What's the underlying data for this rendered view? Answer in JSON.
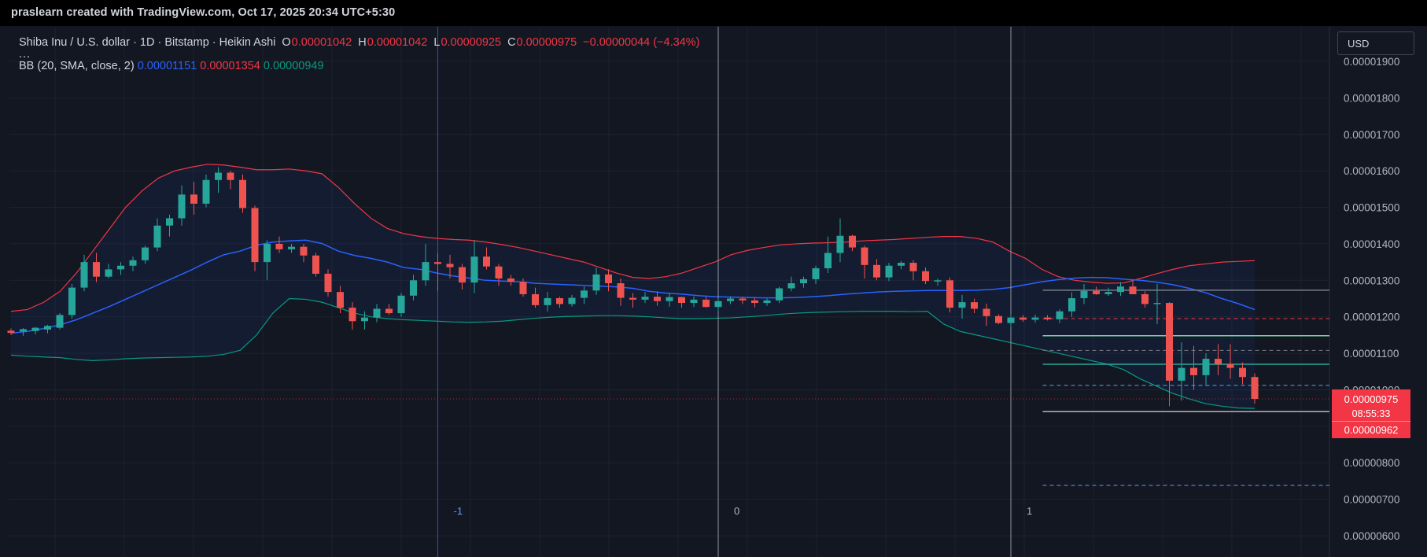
{
  "header": {
    "credit": "praslearn created with TradingView.com, Oct 17, 2025 20:34 UTC+5:30"
  },
  "legend": {
    "symbol": "Shiba Inu / U.S. dollar · 1D · Bitstamp · Heikin Ashi",
    "open_label": "O",
    "open": "0.00001042",
    "high_label": "H",
    "high": "0.00001042",
    "low_label": "L",
    "low": "0.00000925",
    "close_label": "C",
    "close": "0.00000975",
    "change": "−0.00000044 (−4.34%)",
    "more": "...",
    "bb_label": "BB (20, SMA, close, 2)",
    "bb_basis": "0.00001151",
    "bb_upper": "0.00001354",
    "bb_lower": "0.00000949"
  },
  "currency_button": "USD",
  "price_box": {
    "last": "0.00000975",
    "timer": "08:55:33",
    "low": "0.00000962"
  },
  "colors": {
    "up": "#089981",
    "down": "#f23645",
    "up_candle": "#26a69a",
    "down_candle": "#ef5350",
    "basis": "#2962ff",
    "upper": "#f23645",
    "lower": "#089981",
    "fill": "#2962ff",
    "orange": "#ff9800",
    "background": "#131722",
    "grid": "#1e222d",
    "text": "#b2b5be"
  },
  "chart_data": {
    "type": "candlestick",
    "style": "heikin-ashi",
    "title": "Shiba Inu / U.S. dollar · 1D · Bitstamp · Heikin Ashi",
    "yaxis": {
      "ticks": [
        "0.00001900",
        "0.00001800",
        "0.00001700",
        "0.00001600",
        "0.00001500",
        "0.00001400",
        "0.00001300",
        "0.00001200",
        "0.00001100",
        "0.00001000",
        "0.00000900",
        "0.00000800",
        "0.00000700",
        "0.00000600"
      ],
      "tick_values": [
        1900,
        1800,
        1700,
        1600,
        1500,
        1400,
        1300,
        1200,
        1100,
        1000,
        900,
        800,
        700,
        600
      ],
      "units": "1e-8 USD",
      "range": [
        580,
        1930
      ]
    },
    "x_markers": [
      {
        "label": "-1",
        "index": 35
      },
      {
        "label": "0",
        "index": 58
      },
      {
        "label": "1",
        "index": 82
      }
    ],
    "candles_ohlc": [
      [
        1162,
        1168,
        1150,
        1156
      ],
      [
        1160,
        1169,
        1148,
        1166
      ],
      [
        1161,
        1172,
        1152,
        1170
      ],
      [
        1165,
        1178,
        1155,
        1175
      ],
      [
        1170,
        1210,
        1165,
        1205
      ],
      [
        1205,
        1290,
        1195,
        1280
      ],
      [
        1280,
        1370,
        1270,
        1350
      ],
      [
        1350,
        1375,
        1295,
        1310
      ],
      [
        1310,
        1345,
        1305,
        1330
      ],
      [
        1330,
        1350,
        1315,
        1340
      ],
      [
        1340,
        1365,
        1325,
        1355
      ],
      [
        1355,
        1395,
        1345,
        1390
      ],
      [
        1390,
        1470,
        1380,
        1450
      ],
      [
        1450,
        1480,
        1420,
        1470
      ],
      [
        1470,
        1560,
        1450,
        1535
      ],
      [
        1535,
        1570,
        1480,
        1510
      ],
      [
        1510,
        1590,
        1500,
        1575
      ],
      [
        1575,
        1610,
        1540,
        1595
      ],
      [
        1595,
        1600,
        1550,
        1575
      ],
      [
        1575,
        1590,
        1485,
        1498
      ],
      [
        1498,
        1505,
        1325,
        1350
      ],
      [
        1350,
        1410,
        1300,
        1400
      ],
      [
        1400,
        1420,
        1375,
        1385
      ],
      [
        1385,
        1400,
        1375,
        1392
      ],
      [
        1392,
        1400,
        1350,
        1368
      ],
      [
        1368,
        1375,
        1310,
        1318
      ],
      [
        1318,
        1330,
        1255,
        1268
      ],
      [
        1268,
        1285,
        1210,
        1225
      ],
      [
        1225,
        1240,
        1165,
        1188
      ],
      [
        1188,
        1215,
        1165,
        1198
      ],
      [
        1198,
        1235,
        1185,
        1222
      ],
      [
        1222,
        1235,
        1205,
        1210
      ],
      [
        1210,
        1265,
        1200,
        1258
      ],
      [
        1258,
        1315,
        1245,
        1300
      ],
      [
        1300,
        1400,
        1285,
        1350
      ],
      [
        1350,
        1375,
        1270,
        1345
      ],
      [
        1345,
        1370,
        1305,
        1336
      ],
      [
        1336,
        1345,
        1275,
        1294
      ],
      [
        1294,
        1410,
        1265,
        1365
      ],
      [
        1365,
        1390,
        1330,
        1338
      ],
      [
        1338,
        1345,
        1285,
        1305
      ],
      [
        1305,
        1315,
        1285,
        1296
      ],
      [
        1296,
        1305,
        1255,
        1262
      ],
      [
        1262,
        1280,
        1225,
        1232
      ],
      [
        1232,
        1268,
        1215,
        1251
      ],
      [
        1251,
        1255,
        1225,
        1235
      ],
      [
        1235,
        1260,
        1228,
        1252
      ],
      [
        1252,
        1283,
        1235,
        1272
      ],
      [
        1272,
        1335,
        1260,
        1316
      ],
      [
        1316,
        1330,
        1270,
        1292
      ],
      [
        1292,
        1305,
        1230,
        1252
      ],
      [
        1252,
        1265,
        1225,
        1247
      ],
      [
        1247,
        1268,
        1238,
        1255
      ],
      [
        1255,
        1270,
        1230,
        1243
      ],
      [
        1243,
        1266,
        1228,
        1254
      ],
      [
        1254,
        1255,
        1225,
        1238
      ],
      [
        1238,
        1256,
        1227,
        1247
      ],
      [
        1247,
        1255,
        1225,
        1227
      ],
      [
        1227,
        1250,
        1215,
        1243
      ],
      [
        1243,
        1256,
        1235,
        1250
      ],
      [
        1250,
        1255,
        1235,
        1245
      ],
      [
        1245,
        1252,
        1226,
        1238
      ],
      [
        1238,
        1250,
        1230,
        1245
      ],
      [
        1245,
        1282,
        1238,
        1278
      ],
      [
        1278,
        1310,
        1270,
        1292
      ],
      [
        1292,
        1310,
        1280,
        1303
      ],
      [
        1303,
        1340,
        1290,
        1333
      ],
      [
        1333,
        1420,
        1320,
        1375
      ],
      [
        1375,
        1470,
        1350,
        1422
      ],
      [
        1422,
        1425,
        1380,
        1390
      ],
      [
        1390,
        1395,
        1305,
        1342
      ],
      [
        1342,
        1358,
        1300,
        1308
      ],
      [
        1308,
        1348,
        1298,
        1340
      ],
      [
        1340,
        1353,
        1330,
        1348
      ],
      [
        1348,
        1355,
        1300,
        1325
      ],
      [
        1325,
        1335,
        1290,
        1298
      ],
      [
        1298,
        1305,
        1285,
        1300
      ],
      [
        1300,
        1308,
        1212,
        1225
      ],
      [
        1225,
        1260,
        1195,
        1240
      ],
      [
        1240,
        1250,
        1210,
        1222
      ],
      [
        1222,
        1236,
        1175,
        1202
      ],
      [
        1202,
        1207,
        1180,
        1183
      ],
      [
        1183,
        1206,
        1172,
        1198
      ],
      [
        1198,
        1205,
        1186,
        1192
      ],
      [
        1192,
        1206,
        1184,
        1198
      ],
      [
        1198,
        1205,
        1190,
        1193
      ],
      [
        1193,
        1220,
        1183,
        1215
      ],
      [
        1215,
        1267,
        1200,
        1251
      ],
      [
        1251,
        1290,
        1235,
        1271
      ],
      [
        1271,
        1283,
        1260,
        1262
      ],
      [
        1262,
        1280,
        1257,
        1268
      ],
      [
        1268,
        1295,
        1257,
        1283
      ],
      [
        1283,
        1300,
        1265,
        1262
      ],
      [
        1262,
        1270,
        1225,
        1235
      ],
      [
        1235,
        1290,
        1180,
        1238
      ],
      [
        1238,
        1240,
        955,
        1025
      ],
      [
        1025,
        1130,
        970,
        1060
      ],
      [
        1060,
        1120,
        1000,
        1040
      ],
      [
        1040,
        1100,
        1010,
        1085
      ],
      [
        1085,
        1125,
        1040,
        1070
      ],
      [
        1070,
        1125,
        1030,
        1060
      ],
      [
        1060,
        1075,
        1015,
        1035
      ],
      [
        1035,
        1045,
        962,
        975
      ]
    ],
    "candle_dates_note": "",
    "bollinger": {
      "params": "BB (20, SMA, close, 2)",
      "basis_last": 1.151e-05,
      "upper_last": 1.354e-05,
      "lower_last": 9.49e-06,
      "basis": [
        1155,
        1160,
        1168,
        1178,
        1192,
        1210,
        1228,
        1248,
        1268,
        1288,
        1308,
        1328,
        1350,
        1370,
        1380,
        1396,
        1405,
        1408,
        1410,
        1401,
        1380,
        1368,
        1360,
        1350,
        1335,
        1330,
        1320,
        1312,
        1306,
        1300,
        1298,
        1296,
        1292,
        1290,
        1288,
        1286,
        1284,
        1282,
        1278,
        1270,
        1265,
        1262,
        1258,
        1255,
        1254,
        1253,
        1252,
        1252,
        1253,
        1255,
        1258,
        1262,
        1265,
        1268,
        1270,
        1271,
        1272,
        1272,
        1272,
        1273,
        1275,
        1280,
        1288,
        1296,
        1302,
        1306,
        1308,
        1307,
        1303,
        1300,
        1295,
        1288,
        1278,
        1266,
        1250,
        1236,
        1220,
        1200,
        1182,
        1170,
        1160,
        1152
      ],
      "upper": [
        1215,
        1220,
        1240,
        1270,
        1320,
        1380,
        1440,
        1500,
        1545,
        1580,
        1600,
        1610,
        1618,
        1616,
        1610,
        1603,
        1603,
        1605,
        1600,
        1592,
        1555,
        1510,
        1470,
        1442,
        1428,
        1420,
        1415,
        1412,
        1410,
        1405,
        1398,
        1390,
        1380,
        1370,
        1360,
        1350,
        1335,
        1320,
        1308,
        1305,
        1310,
        1320,
        1335,
        1350,
        1370,
        1382,
        1390,
        1397,
        1400,
        1402,
        1403,
        1405,
        1408,
        1410,
        1412,
        1415,
        1418,
        1420,
        1420,
        1415,
        1405,
        1380,
        1360,
        1330,
        1310,
        1300,
        1295,
        1292,
        1293,
        1305,
        1318,
        1330,
        1340,
        1345,
        1350,
        1352,
        1354
      ],
      "lower": [
        1095,
        1092,
        1090,
        1088,
        1083,
        1080,
        1082,
        1085,
        1087,
        1088,
        1089,
        1090,
        1092,
        1097,
        1108,
        1150,
        1210,
        1250,
        1248,
        1240,
        1225,
        1210,
        1200,
        1195,
        1192,
        1190,
        1188,
        1186,
        1185,
        1186,
        1188,
        1192,
        1196,
        1199,
        1201,
        1202,
        1203,
        1203,
        1202,
        1200,
        1197,
        1195,
        1195,
        1196,
        1197,
        1200,
        1203,
        1207,
        1210,
        1212,
        1213,
        1214,
        1215,
        1215,
        1215,
        1214,
        1215,
        1180,
        1160,
        1150,
        1140,
        1130,
        1120,
        1110,
        1100,
        1090,
        1080,
        1070,
        1055,
        1030,
        1010,
        990,
        975,
        962,
        955,
        950,
        949
      ]
    },
    "horizontal_levels": [
      {
        "value": 1273,
        "style": "solid",
        "color": "#787b86"
      },
      {
        "value": 1195,
        "style": "dashed",
        "color": "#f23645"
      },
      {
        "value": 1148,
        "style": "solid",
        "color": "#7ed69e"
      },
      {
        "value": 1108,
        "style": "dashed",
        "color": "#787b86"
      },
      {
        "value": 1070,
        "style": "solid",
        "color": "#26a69a"
      },
      {
        "value": 1012,
        "style": "dashed",
        "color": "#5b9cf6"
      },
      {
        "value": 940,
        "style": "solid",
        "color": "#b2b5be"
      },
      {
        "value": 738,
        "style": "dashed",
        "color": "#5b9cf6"
      },
      {
        "value": 975,
        "style": "dotted",
        "color": "#f23645"
      }
    ],
    "grid": true,
    "legend_position": "top-left"
  }
}
